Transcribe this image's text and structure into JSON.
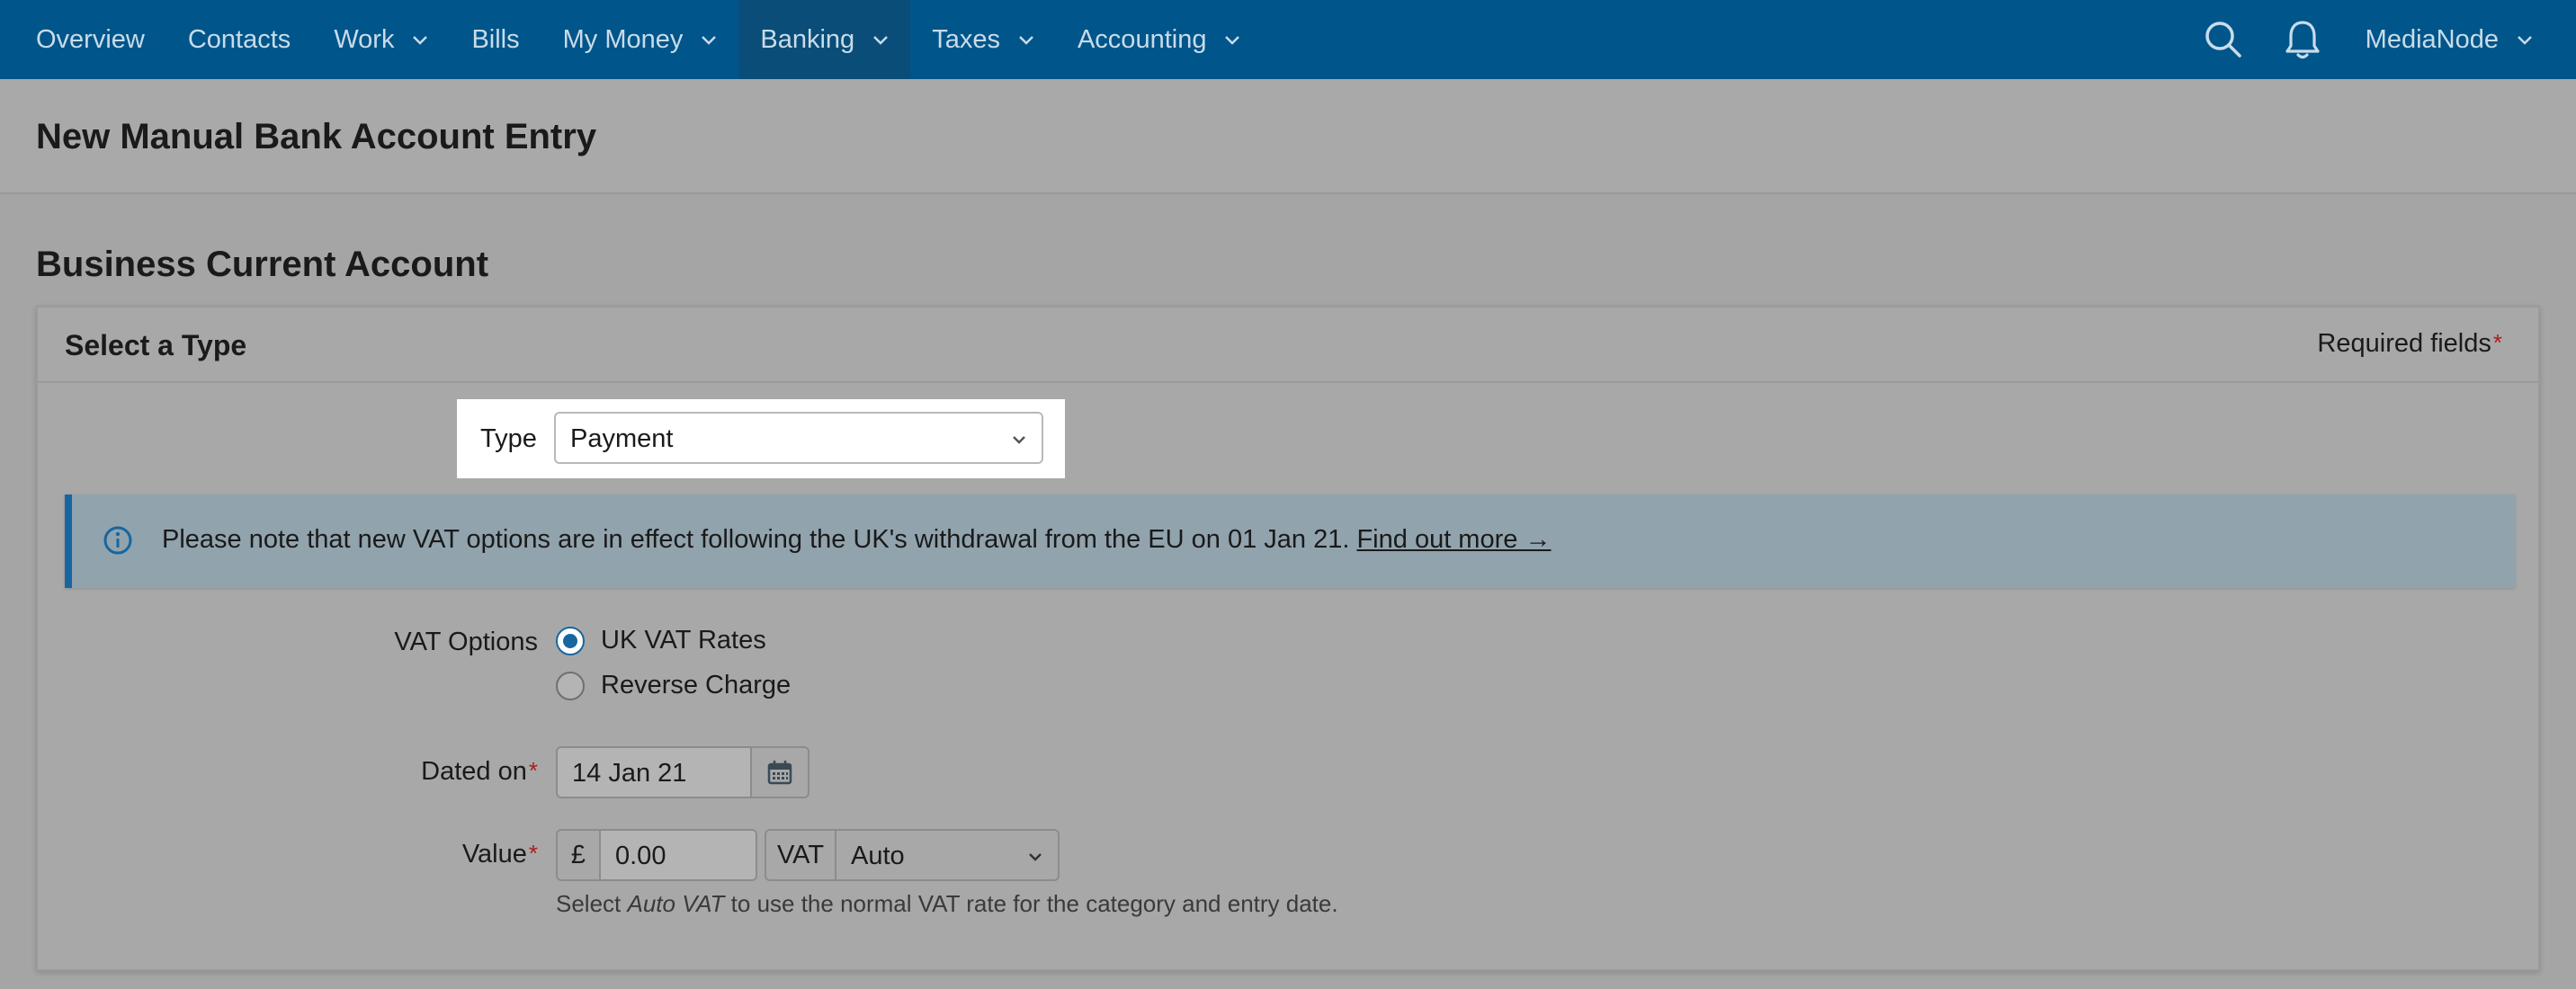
{
  "nav": {
    "items": [
      {
        "label": "Overview",
        "has_menu": false,
        "active": false
      },
      {
        "label": "Contacts",
        "has_menu": false,
        "active": false
      },
      {
        "label": "Work",
        "has_menu": true,
        "active": false
      },
      {
        "label": "Bills",
        "has_menu": false,
        "active": false
      },
      {
        "label": "My Money",
        "has_menu": true,
        "active": false
      },
      {
        "label": "Banking",
        "has_menu": true,
        "active": true
      },
      {
        "label": "Taxes",
        "has_menu": true,
        "active": false
      },
      {
        "label": "Accounting",
        "has_menu": true,
        "active": false
      }
    ],
    "user": "MediaNode",
    "icons": [
      "search-icon",
      "bell-icon"
    ]
  },
  "page": {
    "title": "New Manual Bank Account Entry",
    "section_title": "Business Current Account"
  },
  "panel": {
    "title": "Select a Type",
    "required_note": "Required fields",
    "required_star": "*"
  },
  "form": {
    "type_label": "Type",
    "type_value": "Payment",
    "info": {
      "text": "Please note that new VAT options are in effect following the UK's withdrawal from the EU on 01 Jan 21.",
      "link": "Find out more →"
    },
    "vat_options_label": "VAT Options",
    "vat_options": [
      {
        "label": "UK VAT Rates",
        "checked": true
      },
      {
        "label": "Reverse Charge",
        "checked": false
      }
    ],
    "dated_on_label": "Dated on",
    "dated_on_value": "14 Jan 21",
    "value_label": "Value",
    "currency_symbol": "£",
    "value": "0.00",
    "vat_addon": "VAT",
    "vat_select_value": "Auto",
    "help": {
      "prefix": "Select",
      "emphasis": "Auto VAT",
      "suffix": "to use the normal VAT rate for the category and entry date."
    }
  },
  "colors": {
    "nav_bg": "#00558a",
    "nav_active": "#0a4d78",
    "accent": "#1766a0",
    "required": "#b01b1b",
    "overlay_bg": "#a5a5a5"
  }
}
